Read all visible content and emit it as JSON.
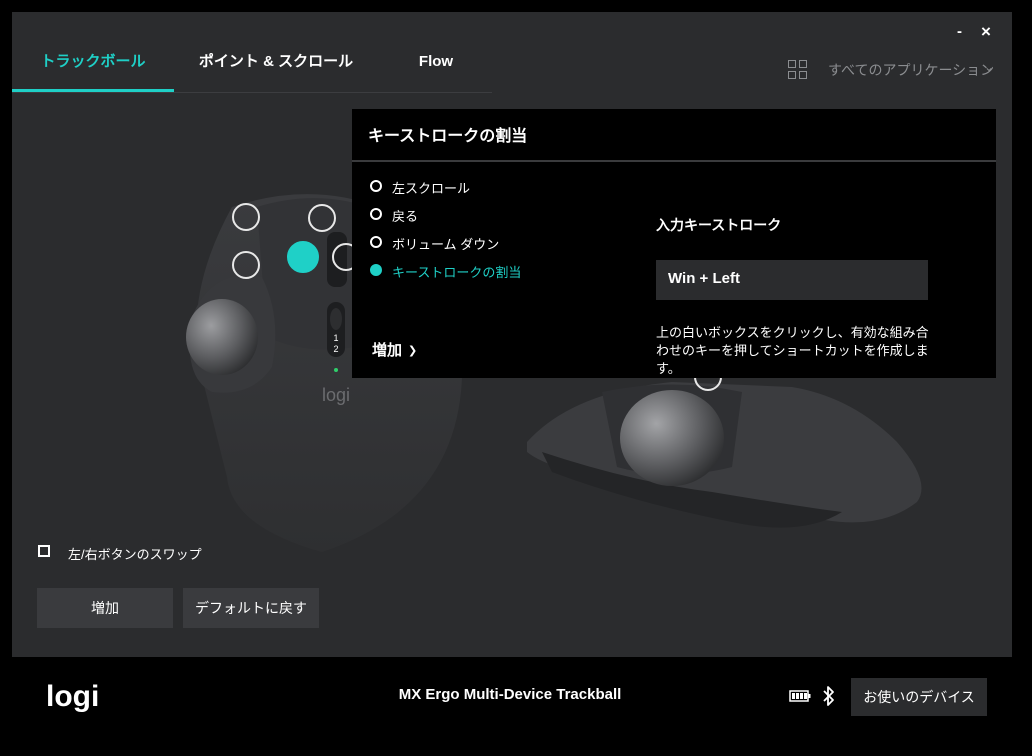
{
  "window": {
    "minimize_label": "-",
    "close_label": "×"
  },
  "tabs": [
    {
      "label": "トラックボール",
      "active": true
    },
    {
      "label": "ポイント & スクロール",
      "active": false
    },
    {
      "label": "Flow",
      "active": false
    }
  ],
  "app_selector": {
    "label": "すべてのアプリケーション",
    "icon": "grid-icon"
  },
  "mouse": {
    "logo_text": "logi",
    "mode_labels": [
      "1",
      "2"
    ]
  },
  "popup": {
    "title": "キーストロークの割当",
    "options": [
      {
        "label": "左スクロール",
        "selected": false
      },
      {
        "label": "戻る",
        "selected": false
      },
      {
        "label": "ボリューム ダウン",
        "selected": false
      },
      {
        "label": "キーストロークの割当",
        "selected": true
      }
    ],
    "add_label": "増加",
    "keystroke_label": "入力キーストローク",
    "keystroke_value": "Win + Left",
    "help_text": "上の白いボックスをクリックし、有効な組み合わせのキーを押してショートカットを作成します。"
  },
  "swap_buttons": {
    "label": "左/右ボタンのスワップ",
    "checked": false
  },
  "buttons": {
    "add_label": "増加",
    "reset_label": "デフォルトに戻す"
  },
  "footer": {
    "logo_text": "logi",
    "device_name": "MX Ergo Multi-Device Trackball",
    "devices_button_label": "お使いのデバイス"
  },
  "colors": {
    "accent": "#1fd0c7",
    "panel": "#2b2c2e",
    "background": "#000000"
  }
}
